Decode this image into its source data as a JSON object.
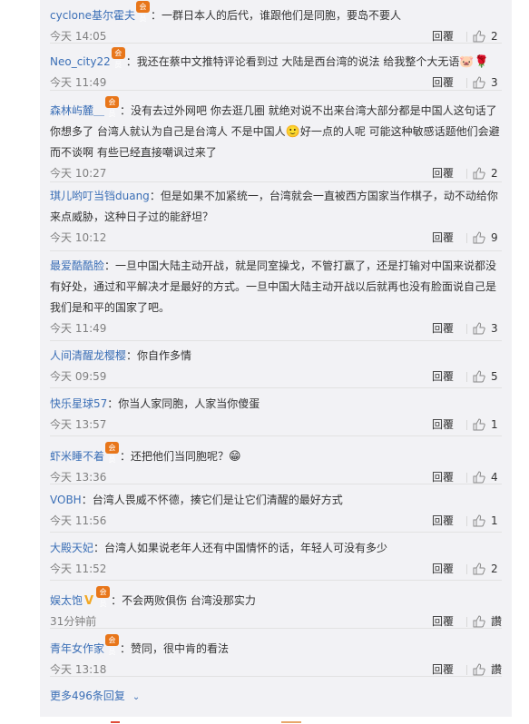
{
  "comments": [
    {
      "user": "cyclone基尔霍夫",
      "badge": "会员",
      "text": "：一群日本人的后代，谁跟他们是同胞，要岛不要人",
      "time": "今天 14:05",
      "reply": "回覆",
      "likes": "2"
    },
    {
      "user": "Neo_city22",
      "badge": "会员",
      "text": "：我还在蔡中文推特评论看到过 大陆是西台湾的说法 给我整个大无语",
      "emoji": "🐷🌹",
      "time": "今天 11:49",
      "reply": "回覆",
      "likes": "3"
    },
    {
      "user": "森林屿麓＿",
      "badge": "会员",
      "text": "：没有去过外网吧 你去逛几圈 就绝对说不出来台湾大部分都是中国人这句话了你想多了 台湾人就认为自己是台湾人 不是中国人",
      "emoji": "🙂",
      "text2": "好一点的人呢 可能这种敏感话题他们会避而不谈啊 有些已经直接嘲讽过来了",
      "time": "今天 10:27",
      "reply": "回覆",
      "likes": "2"
    },
    {
      "user": "琪儿哟叮当铛duang",
      "text": "：但是如果不加紧统一，台湾就会一直被西方国家当作棋子，动不动给你来点威胁，这种日子过的能舒坦？",
      "time": "今天 10:12",
      "reply": "回覆",
      "likes": "9"
    },
    {
      "user": "最爱酷酷脸",
      "text": "：一旦中国大陆主动开战，就是同室操戈，不管打赢了，还是打输对中国来说都没有好处，通过和平解决才是最好的方式。一旦中国大陆主动开战以后就再也没有脸面说自己是我们是和平的国家了吧。",
      "time": "今天 11:49",
      "reply": "回覆",
      "likes": "3"
    },
    {
      "user": "人间清醒龙樱樱",
      "text": "：你自作多情",
      "time": "今天 09:59",
      "reply": "回覆",
      "likes": "5"
    },
    {
      "user": "快乐星球57",
      "text": "：你当人家同胞，人家当你傻蛋",
      "time": "今天 13:57",
      "reply": "回覆",
      "likes": "1"
    },
    {
      "user": "虾米睡不着",
      "badge": "会员",
      "text": "：还把他们当同胞呢？",
      "emoji": "😁",
      "time": "今天 13:36",
      "reply": "回覆",
      "likes": "4"
    },
    {
      "user": "VOBH",
      "text": "：台湾人畏威不怀德，揍它们是让它们清醒的最好方式",
      "time": "今天 11:56",
      "reply": "回覆",
      "likes": "1"
    },
    {
      "user": "大殿天妃",
      "text": "：台湾人如果说老年人还有中国情怀的话，年轻人可没有多少",
      "time": "今天 11:52",
      "reply": "回覆",
      "likes": "2"
    },
    {
      "user": "娱太饱",
      "vbadge": "V",
      "badge": "会员",
      "text": "：不会两败俱伤 台湾没那实力",
      "time": "31分钟前",
      "reply": "回覆",
      "likes": "讚"
    },
    {
      "user": "青年女作家",
      "badge": "会员",
      "text": "：赞同，很中肯的看法",
      "time": "今天 13:18",
      "reply": "回覆",
      "likes": "讚"
    }
  ],
  "more_label": "更多496条回复",
  "colors": {
    "link": "#3b6fb6",
    "panel": "#f2f2f5",
    "badge": "#e8761a"
  }
}
